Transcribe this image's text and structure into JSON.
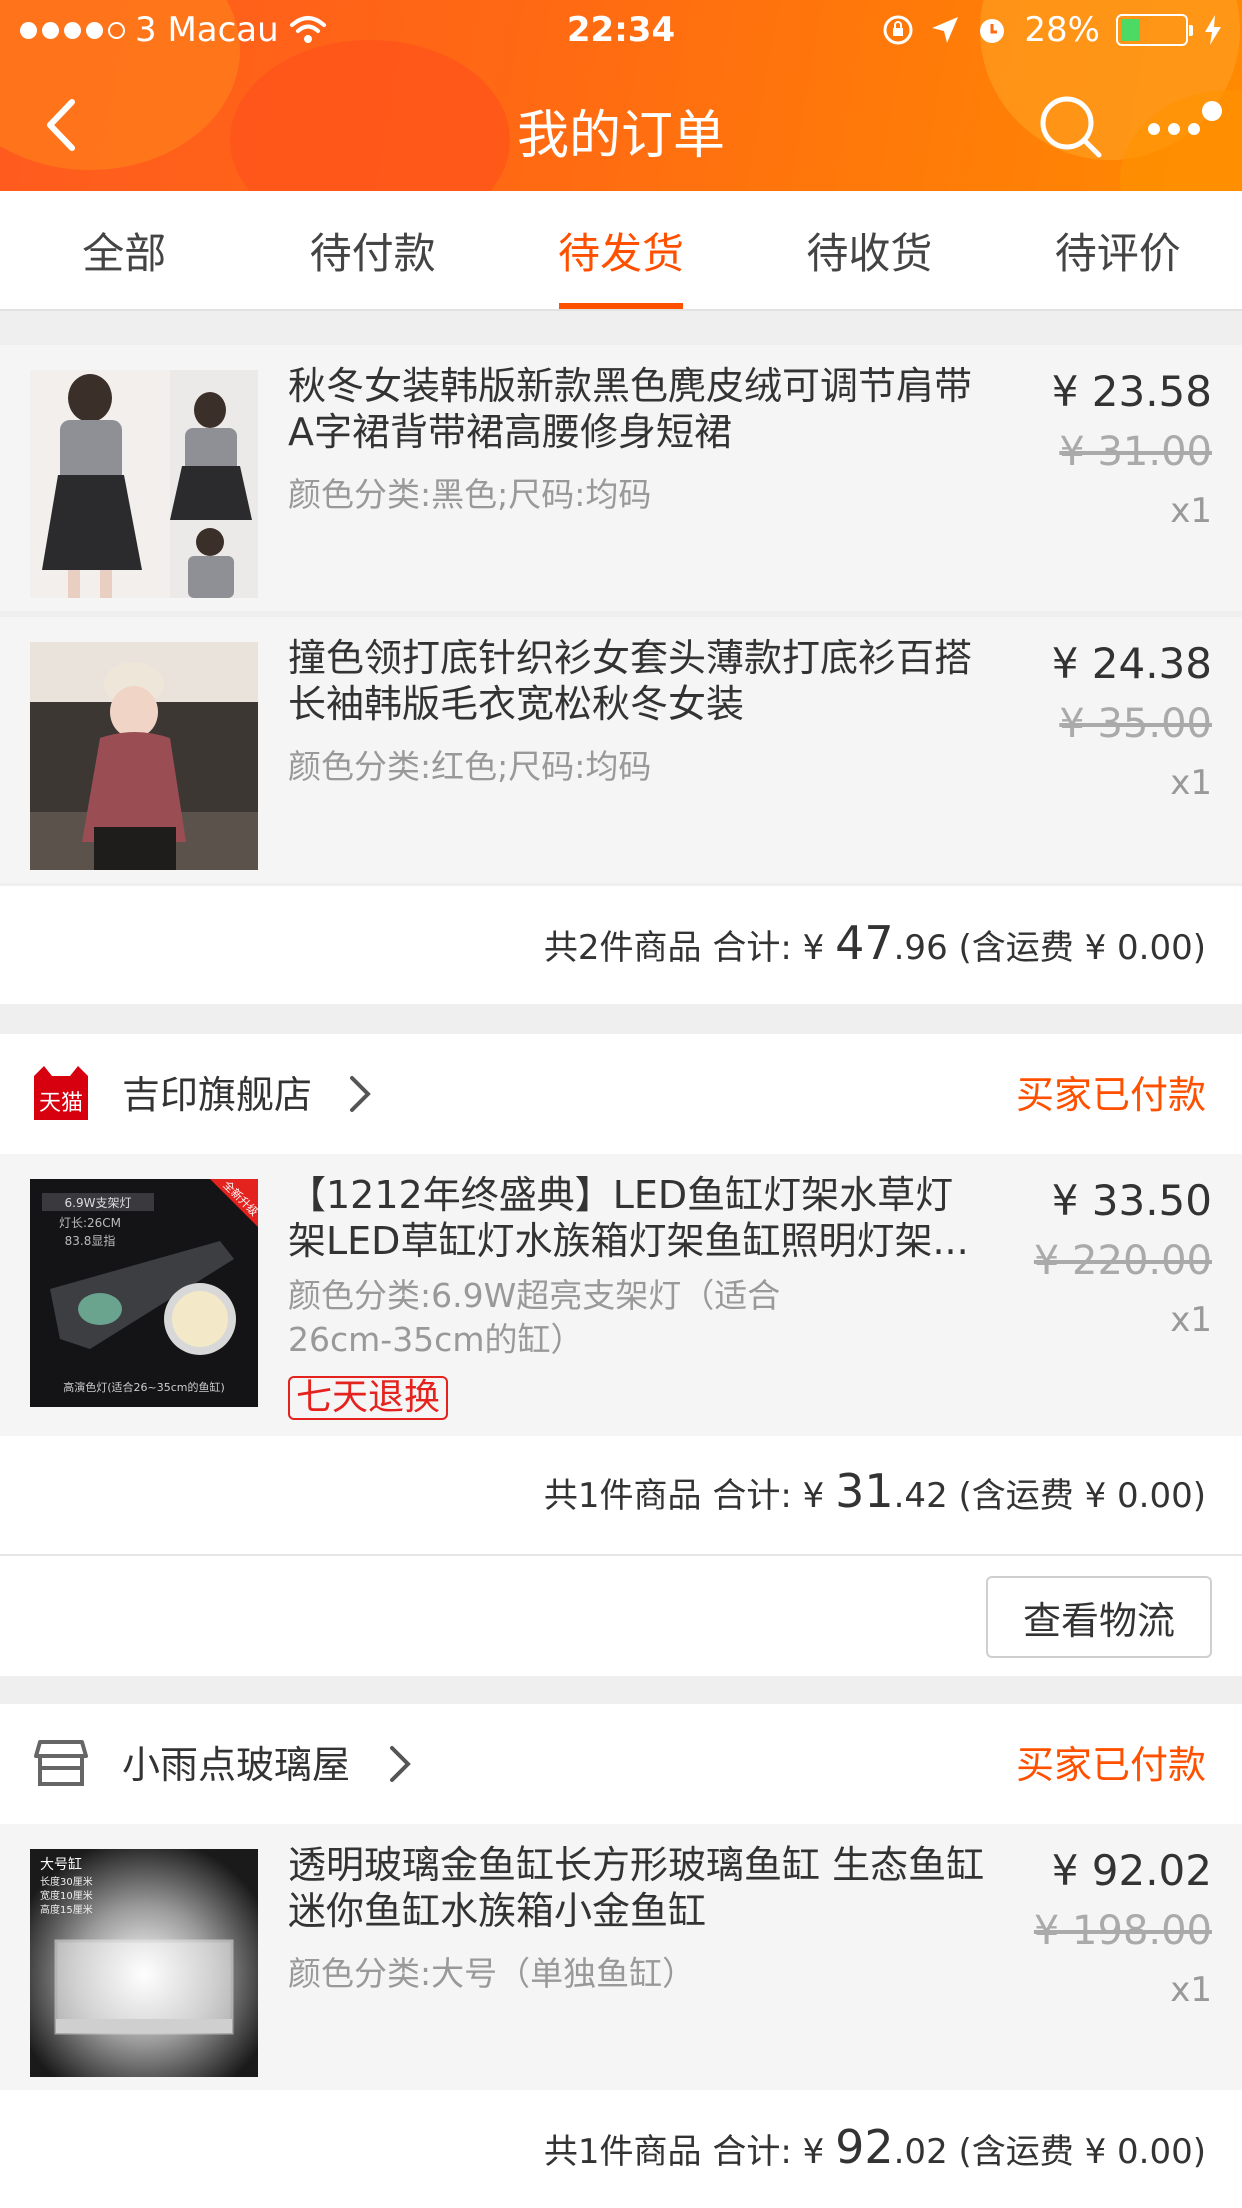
{
  "status_bar": {
    "carrier": "3 Macau",
    "time": "22:34",
    "battery": "28%",
    "battery_level": 0.28
  },
  "nav": {
    "title": "我的订单",
    "back_icon": "chevron-left-icon",
    "search_icon": "search-icon",
    "more_icon": "more-icon"
  },
  "tabs": [
    {
      "label": "全部",
      "active": false
    },
    {
      "label": "待付款",
      "active": false
    },
    {
      "label": "待发货",
      "active": true
    },
    {
      "label": "待收货",
      "active": false
    },
    {
      "label": "待评价",
      "active": false
    }
  ],
  "orders": [
    {
      "items": [
        {
          "name": "秋冬女装韩版新款黑色麂皮绒可调节肩带A字裙背带裙高腰修身短裙",
          "spec": "颜色分类:黑色;尺码:均码",
          "price": "¥ 23.58",
          "orig": "¥ 31.00",
          "qty": "x1"
        },
        {
          "name": "撞色领打底针织衫女套头薄款打底衫百搭长袖韩版毛衣宽松秋冬女装",
          "spec": "颜色分类:红色;尺码:均码",
          "price": "¥ 24.38",
          "orig": "¥ 35.00",
          "qty": "x1"
        }
      ],
      "summary": {
        "count": "共2件商品 合计: ¥ ",
        "int": "47",
        "dec": ".96",
        "shipping": " (含运费 ¥ 0.00)"
      }
    },
    {
      "shop": {
        "name": "吉印旗舰店",
        "status": "买家已付款",
        "logo_icon": "tmall-icon",
        "logo_text": "天猫"
      },
      "items": [
        {
          "name": "【1212年终盛典】LED鱼缸灯架水草灯架LED草缸灯水族箱灯架鱼缸照明灯架...",
          "spec": "颜色分类:6.9W超亮支架灯（适合26cm-35cm的缸）",
          "price": "¥ 33.50",
          "orig": "¥ 220.00",
          "qty": "x1",
          "badge": "七天退换",
          "thumb_text": {
            "t1": "6.9W支架灯",
            "t2": "灯长:26CM",
            "t3": "83.8显指",
            "t4": "高演色灯(适合26~35cm的鱼缸)",
            "t5": "全新升级"
          }
        }
      ],
      "summary": {
        "count": "共1件商品 合计: ¥ ",
        "int": "31",
        "dec": ".42",
        "shipping": " (含运费 ¥ 0.00)"
      },
      "action": "查看物流"
    },
    {
      "shop": {
        "name": "小雨点玻璃屋",
        "status": "买家已付款",
        "logo_icon": "store-icon"
      },
      "items": [
        {
          "name": "透明玻璃金鱼缸长方形玻璃鱼缸 生态鱼缸 迷你鱼缸水族箱小金鱼缸",
          "spec": "颜色分类:大号（单独鱼缸）",
          "price": "¥ 92.02",
          "orig": "¥ 198.00",
          "qty": "x1",
          "thumb_text": {
            "t1": "大号缸",
            "t2": "长度30厘米",
            "t3": "宽度10厘米",
            "t4": "高度15厘米"
          }
        }
      ],
      "summary": {
        "count": "共1件商品 合计: ¥ ",
        "int": "92",
        "dec": ".02",
        "shipping": " (含运费 ¥ 0.00)"
      }
    }
  ]
}
